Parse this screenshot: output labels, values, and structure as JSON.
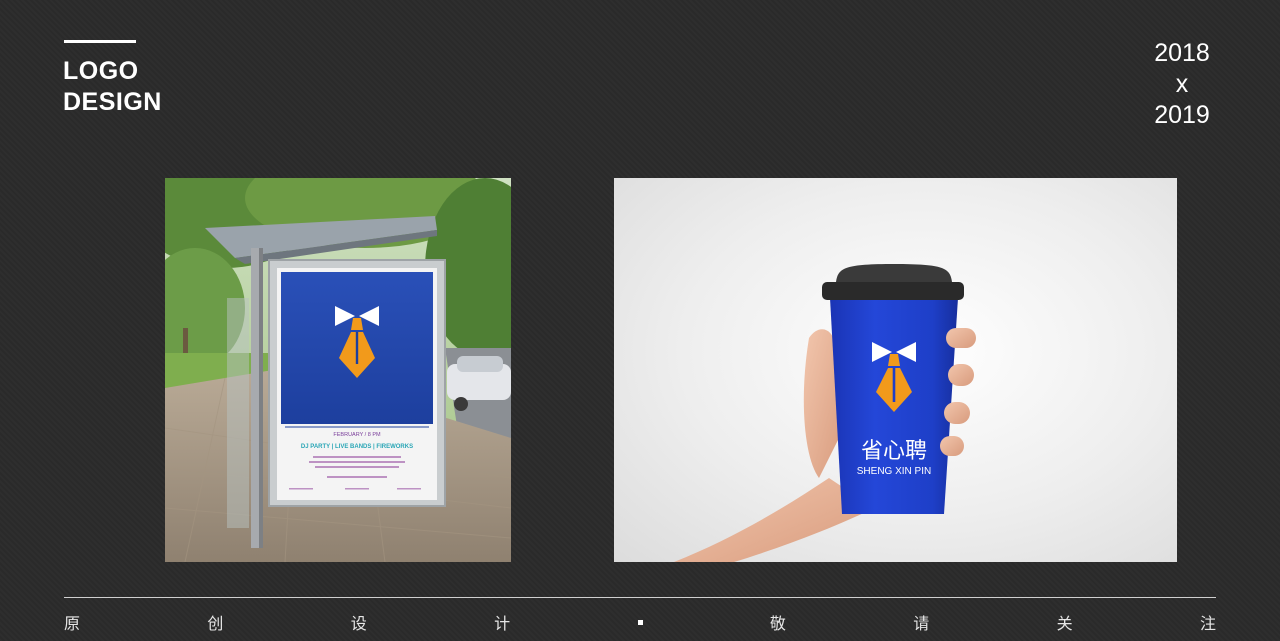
{
  "header": {
    "title_line1": "LOGO",
    "title_line2": "DESIGN",
    "year_start": "2018",
    "year_separator": "x",
    "year_end": "2019"
  },
  "poster": {
    "date_line": "FEBRUARY / 8 PM",
    "headline": "DJ PARTY | LIVE BANDS | FIREWORKS"
  },
  "cup": {
    "brand_cn": "省心聘",
    "brand_en": "SHENG XIN PIN"
  },
  "footer": {
    "chars": [
      "原",
      "创",
      "设",
      "计",
      "敬",
      "请",
      "关",
      "注"
    ]
  },
  "colors": {
    "brand_blue": "#1e3fc8",
    "brand_orange": "#f29a1b",
    "background": "#2b2b2b"
  }
}
